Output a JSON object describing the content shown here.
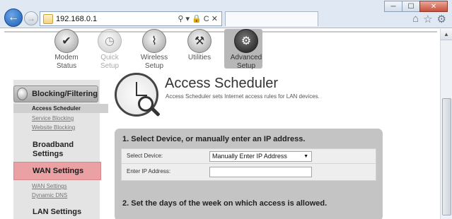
{
  "browser": {
    "url": "192.168.0.1",
    "address_controls": "⚲ ▾ 🔒 C ✕",
    "window_buttons": [
      "─",
      "☐",
      "✕"
    ],
    "toolbar_icons": [
      "⌂",
      "☆",
      "⚙"
    ]
  },
  "topnav": {
    "items": [
      {
        "label_line1": "Modem",
        "label_line2": "Status",
        "icon": "check-icon"
      },
      {
        "label_line1": "Quick",
        "label_line2": "Setup",
        "icon": "stopwatch-icon"
      },
      {
        "label_line1": "Wireless",
        "label_line2": "Setup",
        "icon": "wireless-icon"
      },
      {
        "label_line1": "Utilities",
        "label_line2": "",
        "icon": "tools-icon"
      },
      {
        "label_line1": "Advanced",
        "label_line2": "Setup",
        "icon": "gears-icon"
      }
    ]
  },
  "sidebar": {
    "header": "Blocking/Filtering",
    "subitems": [
      "Access Scheduler",
      "Service Blocking",
      "Website Blocking"
    ],
    "group_broadband_line1": "Broadband",
    "group_broadband_line2": "Settings",
    "wan_header": "WAN Settings",
    "wan_subitems": [
      "WAN Settings",
      "Dynamic DNS"
    ],
    "lan_header": "LAN Settings"
  },
  "page": {
    "title": "Access Scheduler",
    "description": "Access Scheduler sets Internet access rules for LAN devices."
  },
  "section1": {
    "title": "1. Select Device, or manually enter an IP address.",
    "device_label": "Select Device:",
    "device_value": "Manually Enter IP Address",
    "ip_label": "Enter IP Address:",
    "ip_value": ""
  },
  "section2": {
    "title": "2. Set the days of the week on which access is allowed."
  }
}
